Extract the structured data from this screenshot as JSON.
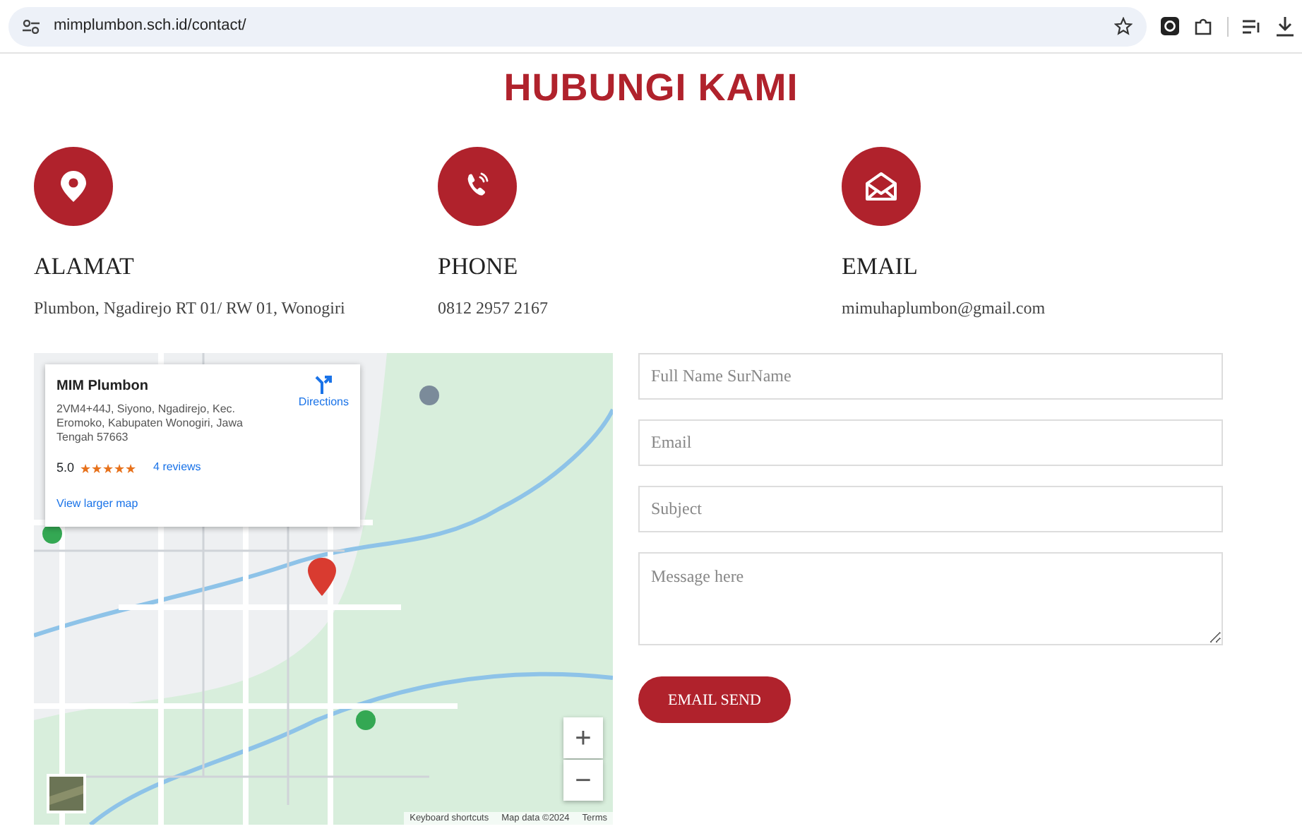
{
  "browser": {
    "url": "mimplumbon.sch.id/contact/"
  },
  "title": "HUBUNGI KAMI",
  "contacts": [
    {
      "kind": "pin",
      "heading": "ALAMAT",
      "text": "Plumbon, Ngadirejo RT 01/ RW 01, Wonogiri"
    },
    {
      "kind": "phone",
      "heading": "PHONE",
      "text": "0812 2957 2167"
    },
    {
      "kind": "mail",
      "heading": "EMAIL",
      "text": "mimuhaplumbon@gmail.com"
    }
  ],
  "map": {
    "kind": "picture",
    "place": {
      "name": "MIM Plumbon",
      "address": "2VM4+44J, Siyono, Ngadirejo, Kec. Eromoko, Kabupaten Wonogiri, Jawa Tengah 57663",
      "rating": "5.0",
      "stars": 5,
      "reviews": "4 reviews",
      "directions": "Directions",
      "larger_map": "View larger map"
    },
    "zoom_in": "+",
    "zoom_out": "−",
    "footer": [
      "Keyboard shortcuts",
      "Map data ©2024",
      "Terms"
    ]
  },
  "form": {
    "fields": [
      {
        "kind": "input",
        "placeholder": "Full Name SurName"
      },
      {
        "kind": "input",
        "placeholder": "Email"
      },
      {
        "kind": "input",
        "placeholder": "Subject"
      },
      {
        "kind": "textarea",
        "placeholder": "Message here"
      }
    ],
    "button": "EMAIL SEND"
  }
}
